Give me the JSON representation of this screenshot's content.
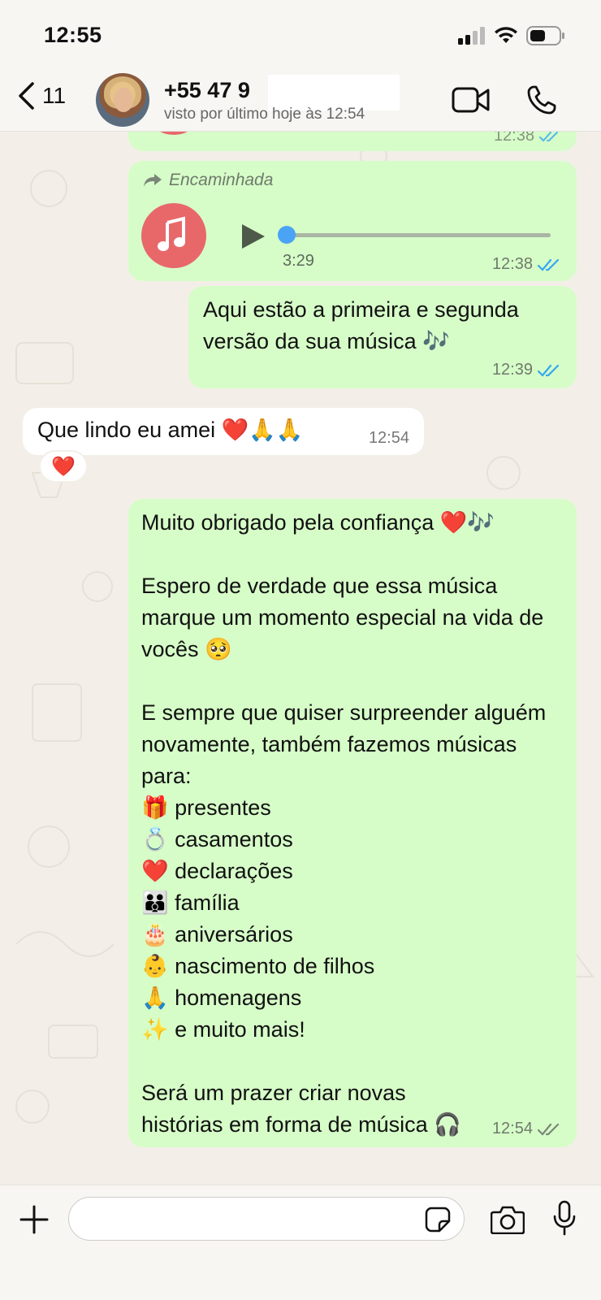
{
  "status_bar": {
    "time": "12:55"
  },
  "header": {
    "back_count": "11",
    "contact_name": "+55 47 9",
    "last_seen": "visto por último hoje às 12:54"
  },
  "messages": {
    "top_partial": {
      "time": "12:38"
    },
    "audio": {
      "forwarded_label": "Encaminhada",
      "duration": "3:29",
      "time": "12:38",
      "progress": 0
    },
    "versions": {
      "text": "Aqui estão a primeira e segunda versão da sua música 🎶",
      "time": "12:39"
    },
    "incoming": {
      "text": "Que lindo eu amei ❤️🙏🙏",
      "time": "12:54",
      "reaction": "❤️"
    },
    "thanks": {
      "paragraphs": [
        "Muito obrigado pela confiança ❤️🎶",
        "Espero de verdade que essa música marque um momento especial na vida de vocês 🥺",
        "E sempre que quiser surpreender alguém novamente, também fazemos músicas para:"
      ],
      "list": [
        {
          "emoji": "🎁",
          "label": "presentes"
        },
        {
          "emoji": "💍",
          "label": "casamentos"
        },
        {
          "emoji": "❤️",
          "label": "declarações"
        },
        {
          "emoji": "👪",
          "label": "família"
        },
        {
          "emoji": "🎂",
          "label": "aniversários"
        },
        {
          "emoji": "👶",
          "label": "nascimento de filhos"
        },
        {
          "emoji": "🙏",
          "label": "homenagens"
        },
        {
          "emoji": "✨",
          "label": "e muito mais!"
        }
      ],
      "closing": "Será um prazer criar novas histórias em forma de música 🎧",
      "time": "12:54"
    }
  },
  "colors": {
    "outgoing_bubble": "#d6fdc8",
    "incoming_bubble": "#ffffff",
    "read_ticks": "#34a7f1",
    "audio_avatar": "#e8686a",
    "progress_dot": "#4aa3f5"
  },
  "icons": {
    "back": "chevron-left-icon",
    "video": "video-camera-icon",
    "call": "phone-icon",
    "attach": "plus-icon",
    "sticker": "sticker-icon",
    "camera": "camera-icon",
    "mic": "microphone-icon"
  }
}
